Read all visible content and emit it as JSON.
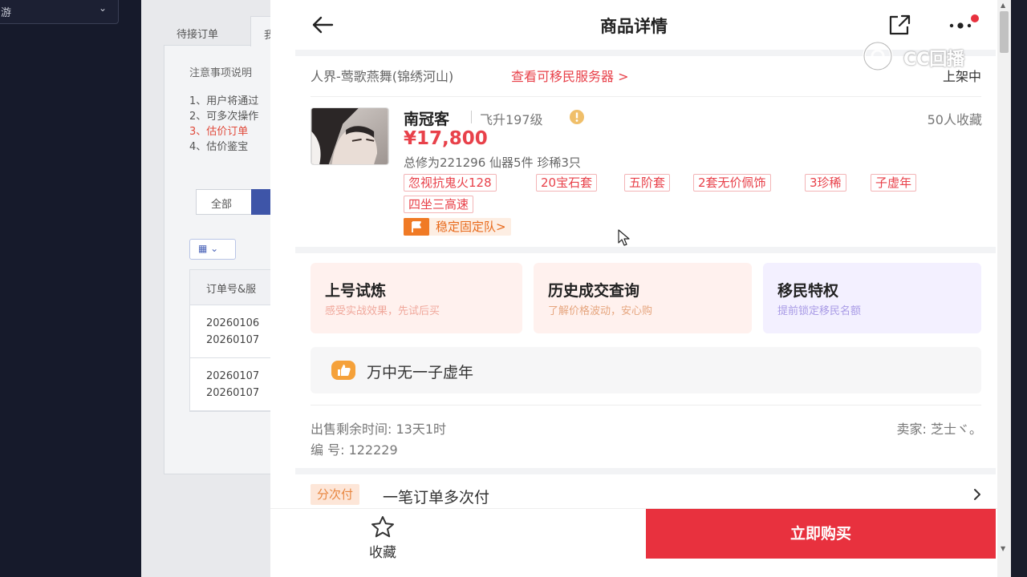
{
  "background": {
    "nav_select_text": "游",
    "tabs": [
      "待接订单",
      "我"
    ],
    "notes_title": "注意事项说明",
    "notes": [
      "1、用户将通过",
      "2、可多次操作",
      "3、估价订单",
      "4、估价鉴宝"
    ],
    "segment_all": "全部",
    "table_header": "订单号&服",
    "table_rows": [
      [
        "20260106",
        "20260107"
      ],
      [
        "20260107",
        "20260107"
      ]
    ]
  },
  "header": {
    "title": "商品详情"
  },
  "server": {
    "name": "人界-莺歌燕舞(锦绣河山)",
    "migrate_link": "查看可移民服务器 >",
    "status": "上架中"
  },
  "role": {
    "name": "南冠客",
    "level": "飞升197级",
    "favorites": "50人收藏",
    "price": "¥17,800",
    "stats": "总修为221296  仙器5件  珍稀3只",
    "tags": [
      "忽视抗鬼火128",
      "20宝石套",
      "五阶套",
      "2套无价佩饰",
      "3珍稀",
      "子虚年",
      "四坐三高速"
    ],
    "team_badge": "稳定固定队>"
  },
  "features": [
    {
      "title": "上号试炼",
      "subtitle": "感受实战效果，先试后买"
    },
    {
      "title": "历史成交查询",
      "subtitle": "了解价格波动，安心购"
    },
    {
      "title": "移民特权",
      "subtitle": "提前锁定移民名额"
    }
  ],
  "highlight": {
    "text": "万中无一子虚年"
  },
  "meta": {
    "remaining": "出售剩余时间: 13天1时",
    "seller": "卖家: 芝士ヾ。",
    "serial": "编  号: 122229"
  },
  "installment": {
    "badge": "分次付",
    "text": "一笔订单多次付"
  },
  "footer": {
    "favorite_label": "收藏",
    "buy_label": "立即购买"
  },
  "watermark": {
    "text": "CC回播"
  },
  "colors": {
    "accent": "#e8313e",
    "orange": "#f07a25"
  },
  "icons": [
    "back-arrow-icon",
    "share-icon",
    "more-icon",
    "warning-icon",
    "flag-icon",
    "thumbs-up-icon",
    "chevron-right-icon",
    "star-icon"
  ]
}
